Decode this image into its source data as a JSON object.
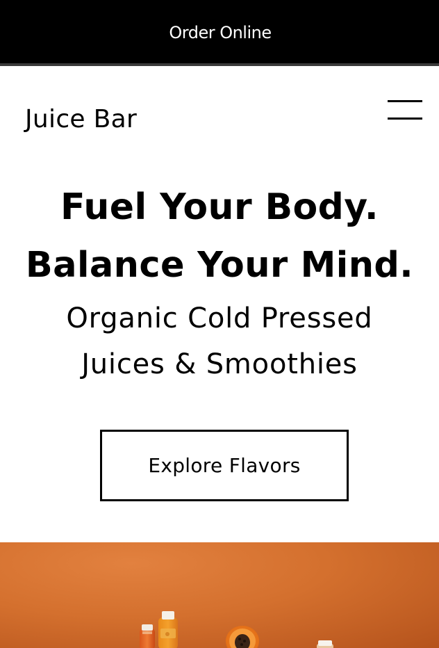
{
  "banner": {
    "label": "Order Online"
  },
  "header": {
    "brand": "Juice Bar",
    "menu_icon": "hamburger-menu-icon"
  },
  "hero": {
    "headline_line1": "Fuel Your Body.",
    "headline_line2": "Balance Your Mind.",
    "subhead_line1": "Organic Cold Pressed",
    "subhead_line2": "Juices & Smoothies",
    "cta_label": "Explore Flavors"
  },
  "colors": {
    "banner_bg": "#000000",
    "banner_text": "#ffffff",
    "page_bg": "#ffffff",
    "text": "#000000",
    "image_bg": "#d4702e"
  }
}
